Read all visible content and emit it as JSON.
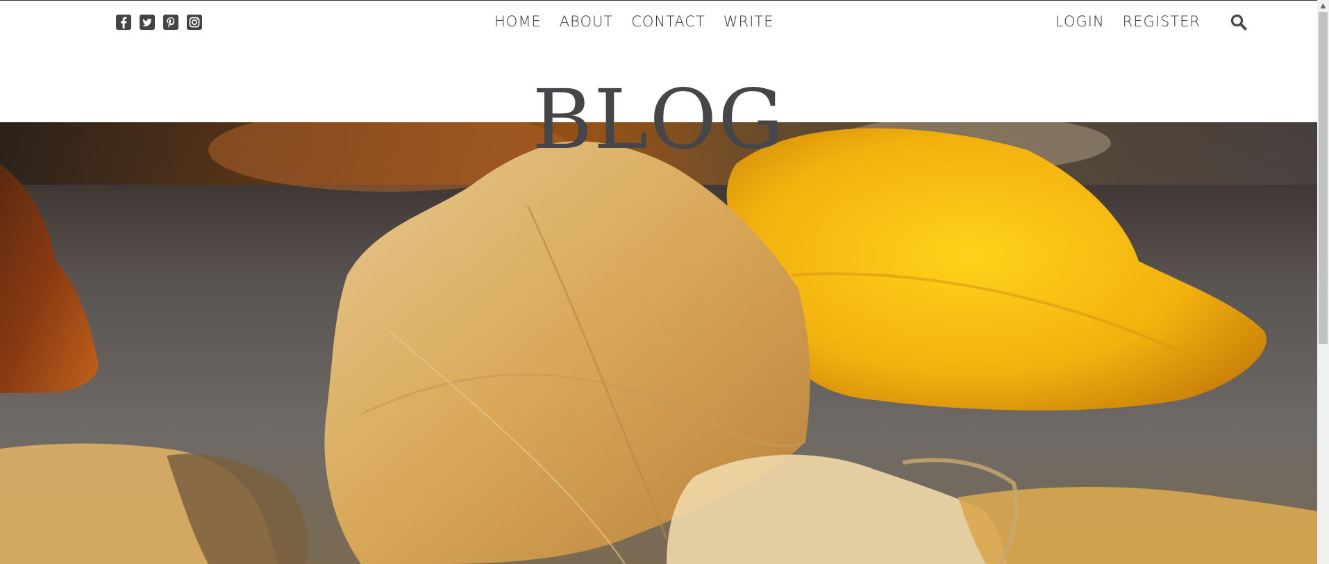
{
  "social": [
    {
      "name": "facebook-icon"
    },
    {
      "name": "twitter-icon"
    },
    {
      "name": "pinterest-icon"
    },
    {
      "name": "instagram-icon"
    }
  ],
  "nav": {
    "items": [
      "HOME",
      "ABOUT",
      "CONTACT",
      "WRITE"
    ]
  },
  "auth": {
    "login": "LOGIN",
    "register": "REGISTER"
  },
  "search": {
    "icon": "search-icon"
  },
  "hero": {
    "title": "BLOG",
    "image": "autumn-leaves-photo"
  },
  "colors": {
    "text": "#333333",
    "title": "#444649",
    "leaf_yellow": "#f2b21a",
    "leaf_tan": "#d9a75a"
  }
}
